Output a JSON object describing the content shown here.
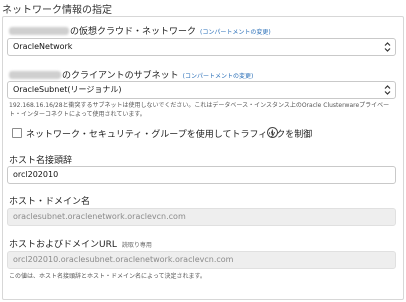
{
  "section_title": "ネットワーク情報の指定",
  "vcn": {
    "label_suffix": "の仮想クラウド・ネットワーク",
    "change_link": "(コンパートメントの変更)",
    "value": "OracleNetwork"
  },
  "subnet": {
    "label_suffix": "のクライアントのサブネット",
    "change_link": "(コンパートメントの変更)",
    "value": "OracleSubnet(リージョナル)",
    "help_text": "192.168.16.16/28と衝突するサブネットは使用しないでください。これはデータベース・インスタンス上のOracle Clusterwareプライベート・インターコネクトによって使用されています。"
  },
  "nsg_checkbox": {
    "label": "ネットワーク・セキュリティ・グループを使用してトラフィックを制御"
  },
  "hostname_prefix": {
    "label": "ホスト名接頭辞",
    "value": "orcl202010"
  },
  "domain_name": {
    "label": "ホスト・ドメイン名",
    "value": "oraclesubnet.oraclenetwork.oraclevcn.com"
  },
  "fqdn": {
    "label": "ホストおよびドメインURL",
    "tag": "読取り専用",
    "value": "orcl202010.oraclesubnet.oraclenetwork.oraclevcn.com",
    "help_text": "この値は、ホスト名接頭辞とホスト・ドメイン名によって決定されます。"
  },
  "icons": {
    "select_chevron": "chevron-updown-icon",
    "info": "info-icon"
  }
}
